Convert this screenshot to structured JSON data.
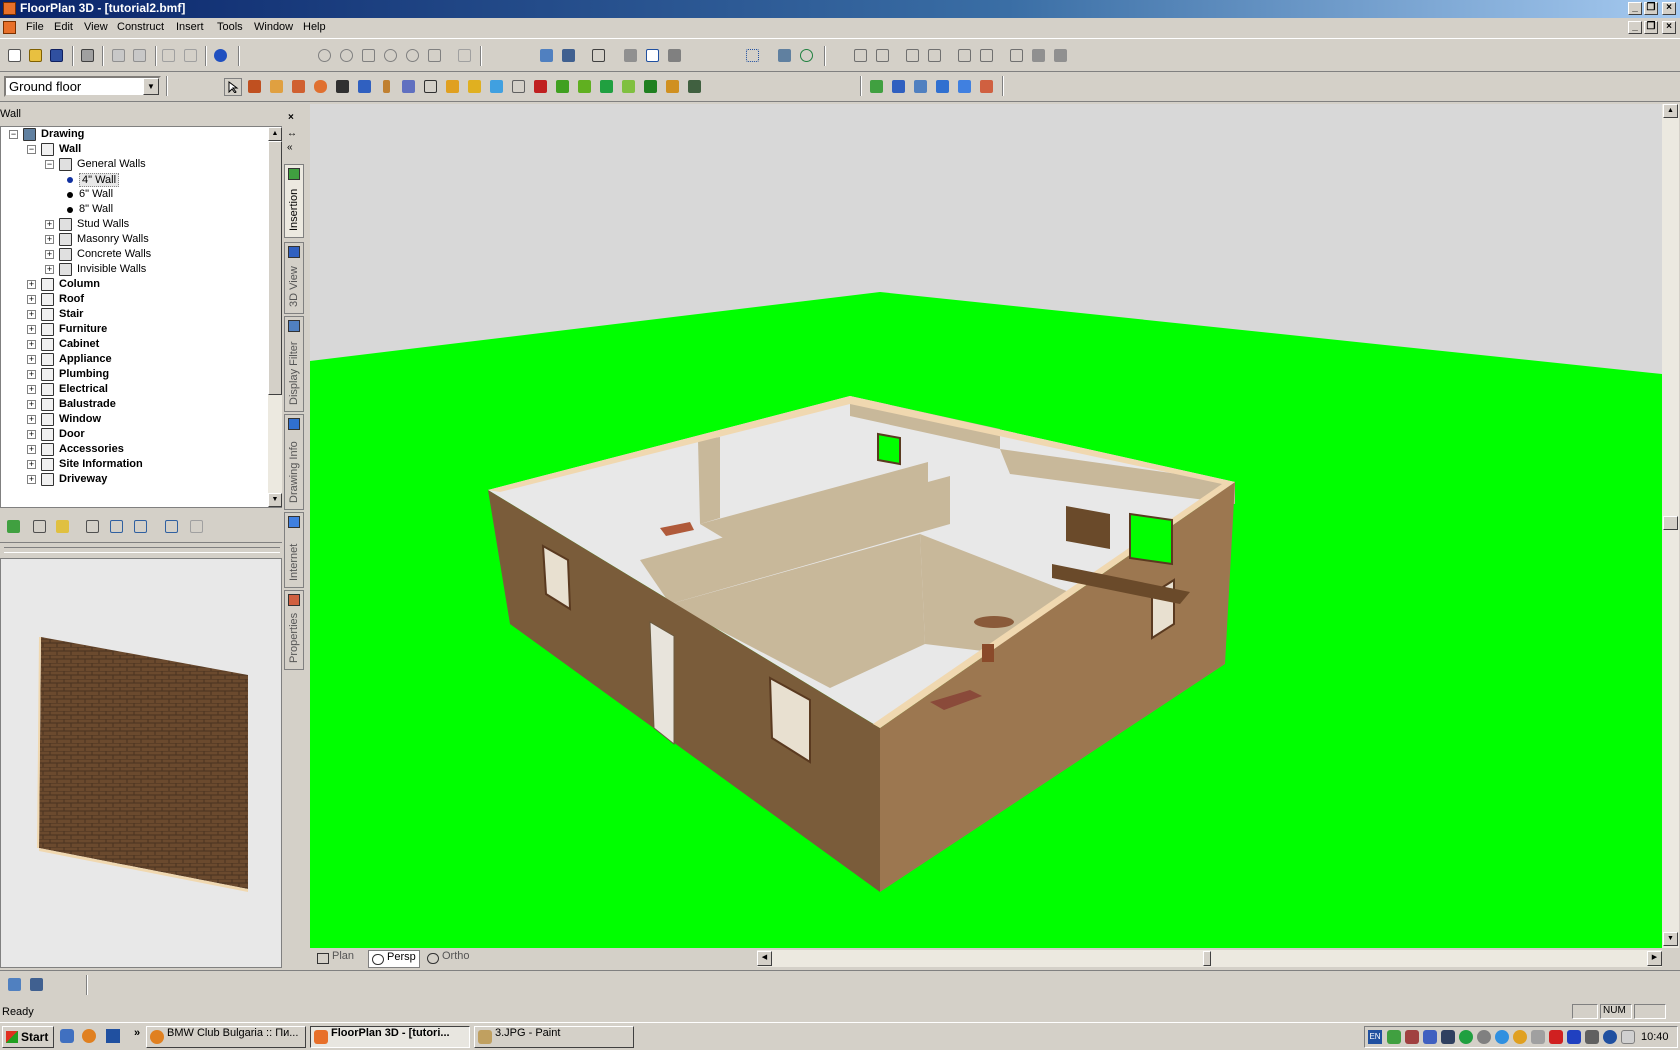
{
  "window": {
    "title": "FloorPlan 3D - [tutorial2.bmf]",
    "minimize_glyph": "_",
    "maximize_glyph": "❐",
    "close_glyph": "×"
  },
  "menu": [
    "File",
    "Edit",
    "View",
    "Construct",
    "Insert",
    "Tools",
    "Window",
    "Help"
  ],
  "floor_selector": {
    "value": "Ground floor"
  },
  "panel": {
    "title": "Wall",
    "tree": [
      {
        "label": "Drawing",
        "level": 0,
        "bold": true,
        "expander": "−",
        "icon": "layers-icon"
      },
      {
        "label": "Wall",
        "level": 1,
        "bold": true,
        "expander": "−",
        "icon": "wall-icon"
      },
      {
        "label": "General Walls",
        "level": 2,
        "bold": false,
        "expander": "−",
        "icon": "folder-icon"
      },
      {
        "label": "4\" Wall",
        "level": 3,
        "bold": false,
        "expander": "",
        "icon": "dot",
        "selected": true
      },
      {
        "label": "6\" Wall",
        "level": 3,
        "bold": false,
        "expander": "",
        "icon": "dot"
      },
      {
        "label": "8\" Wall",
        "level": 3,
        "bold": false,
        "expander": "",
        "icon": "dot"
      },
      {
        "label": "Stud Walls",
        "level": 2,
        "bold": false,
        "expander": "+",
        "icon": "folder-icon"
      },
      {
        "label": "Masonry Walls",
        "level": 2,
        "bold": false,
        "expander": "+",
        "icon": "folder-icon"
      },
      {
        "label": "Concrete Walls",
        "level": 2,
        "bold": false,
        "expander": "+",
        "icon": "folder-icon"
      },
      {
        "label": "Invisible Walls",
        "level": 2,
        "bold": false,
        "expander": "+",
        "icon": "folder-icon"
      },
      {
        "label": "Column",
        "level": 1,
        "bold": true,
        "expander": "+",
        "icon": "column-icon"
      },
      {
        "label": "Roof",
        "level": 1,
        "bold": true,
        "expander": "+",
        "icon": "roof-icon"
      },
      {
        "label": "Stair",
        "level": 1,
        "bold": true,
        "expander": "+",
        "icon": "stair-icon"
      },
      {
        "label": "Furniture",
        "level": 1,
        "bold": true,
        "expander": "+",
        "icon": "furniture-icon"
      },
      {
        "label": "Cabinet",
        "level": 1,
        "bold": true,
        "expander": "+",
        "icon": "cabinet-icon"
      },
      {
        "label": "Appliance",
        "level": 1,
        "bold": true,
        "expander": "+",
        "icon": "appliance-icon"
      },
      {
        "label": "Plumbing",
        "level": 1,
        "bold": true,
        "expander": "+",
        "icon": "plumbing-icon"
      },
      {
        "label": "Electrical",
        "level": 1,
        "bold": true,
        "expander": "+",
        "icon": "electrical-icon"
      },
      {
        "label": "Balustrade",
        "level": 1,
        "bold": true,
        "expander": "+",
        "icon": "balustrade-icon"
      },
      {
        "label": "Window",
        "level": 1,
        "bold": true,
        "expander": "+",
        "icon": "window-icon"
      },
      {
        "label": "Door",
        "level": 1,
        "bold": true,
        "expander": "+",
        "icon": "door-icon"
      },
      {
        "label": "Accessories",
        "level": 1,
        "bold": true,
        "expander": "+",
        "icon": "accessories-icon"
      },
      {
        "label": "Site Information",
        "level": 1,
        "bold": true,
        "expander": "+",
        "icon": "site-icon"
      },
      {
        "label": "Driveway",
        "level": 1,
        "bold": true,
        "expander": "+",
        "icon": "driveway-icon"
      }
    ]
  },
  "side_tabs": [
    "Insertion",
    "3D View",
    "Display Filter",
    "Drawing Info",
    "Internet",
    "Properties"
  ],
  "side_tab_controls": [
    "×",
    "↔",
    "«"
  ],
  "view_tabs": [
    "Plan",
    "Persp",
    "Ortho"
  ],
  "active_view_tab": "Persp",
  "status": {
    "text": "Ready",
    "num": "NUM"
  },
  "taskbar": {
    "start": "Start",
    "more": "»",
    "tasks": [
      {
        "label": "BMW Club Bulgaria :: Пи...",
        "active": false
      },
      {
        "label": "FloorPlan 3D - [tutori...",
        "active": true
      },
      {
        "label": "3.JPG - Paint",
        "active": false
      }
    ],
    "lang": "EN",
    "clock": "10:40"
  },
  "colors": {
    "ground": "#00ff00",
    "sky": "#d8d8d8",
    "wall_outer_left": "#7a5c3a",
    "wall_outer_right": "#9c7750",
    "wall_top": "#f0d8b0",
    "floor": "#e8e8e8",
    "interior_wall": "#c8b89a"
  }
}
